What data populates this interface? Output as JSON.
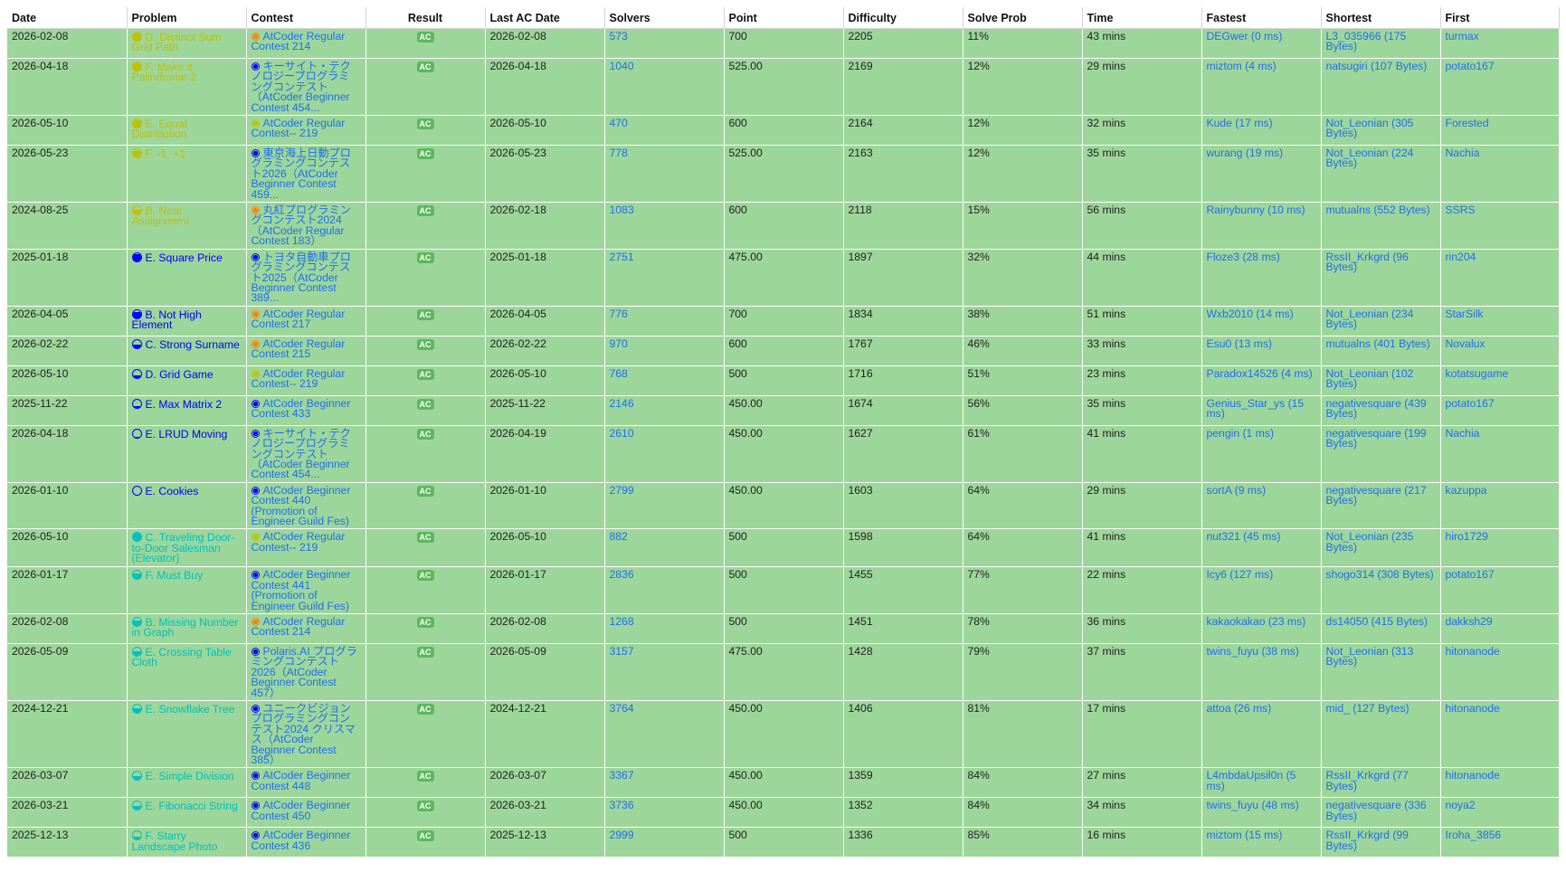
{
  "colors": {
    "row_bg": "#9dd69a",
    "link": "#1e6ff0",
    "yellow": "#c0c000",
    "blue": "#0000ff",
    "cyan": "#00c0c0",
    "ac_badge": "#5cb85c",
    "contest_abc": "#0000ff",
    "contest_arc": "#ff8000",
    "contest_arc_div": "#c0c000"
  },
  "headers": [
    "Date",
    "Problem",
    "Contest",
    "Result",
    "Last AC Date",
    "Solvers",
    "Point",
    "Difficulty",
    "Solve Prob",
    "Time",
    "Fastest",
    "Shortest",
    "First"
  ],
  "rows": [
    {
      "date": "2026-02-08",
      "problem": "D. Distinct Sum Grid Path",
      "color": "yellow",
      "fill": 0.9,
      "contest": "AtCoder Regular Contest 214",
      "ctype": "arc",
      "result": "AC",
      "last_ac": "2026-02-08",
      "solvers": "573",
      "point": "700",
      "difficulty": "2205",
      "prob": "11%",
      "time": "43 mins",
      "fastest": "DEGwer (0 ms)",
      "shortest": "L3_035966 (175 Bytes)",
      "first": "turmax"
    },
    {
      "date": "2026-04-18",
      "problem": "F. Make it Palindrome 2",
      "color": "yellow",
      "fill": 0.85,
      "contest": "キーサイト・テクノロジープログラミングコンテスト（AtCoder Beginner Contest 454...",
      "ctype": "abc",
      "result": "AC",
      "last_ac": "2026-04-18",
      "solvers": "1040",
      "point": "525.00",
      "difficulty": "2169",
      "prob": "12%",
      "time": "29 mins",
      "fastest": "miztom (4 ms)",
      "shortest": "natsugiri (107 Bytes)",
      "first": "potato167"
    },
    {
      "date": "2026-05-10",
      "problem": "E. Equal Distribution",
      "color": "yellow",
      "fill": 0.85,
      "contest": "AtCoder Regular Contest-- 219",
      "ctype": "arcdiv",
      "result": "AC",
      "last_ac": "2026-05-10",
      "solvers": "470",
      "point": "600",
      "difficulty": "2164",
      "prob": "12%",
      "time": "32 mins",
      "fastest": "Kude (17 ms)",
      "shortest": "Not_Leonian (305 Bytes)",
      "first": "Forested"
    },
    {
      "date": "2026-05-23",
      "problem": "F. -1, +1",
      "color": "yellow",
      "fill": 0.8,
      "contest": "東京海上日動プログラミングコンテスト2026（AtCoder Beginner Contest 459...",
      "ctype": "abc",
      "result": "AC",
      "last_ac": "2026-05-23",
      "solvers": "778",
      "point": "525.00",
      "difficulty": "2163",
      "prob": "12%",
      "time": "35 mins",
      "fastest": "wurang (19 ms)",
      "shortest": "Not_Leonian (224 Bytes)",
      "first": "Nachia"
    },
    {
      "date": "2024-08-25",
      "problem": "B. Near Assignment",
      "color": "yellow",
      "fill": 0.6,
      "contest": "丸紅プログラミングコンテスト2024（AtCoder Regular Contest 183）",
      "ctype": "arc",
      "result": "AC",
      "last_ac": "2026-02-18",
      "solvers": "1083",
      "point": "600",
      "difficulty": "2118",
      "prob": "15%",
      "time": "56 mins",
      "fastest": "Rainybunny (10 ms)",
      "shortest": "mutualns (552 Bytes)",
      "first": "SSRS"
    },
    {
      "date": "2025-01-18",
      "problem": "E. Square Price",
      "color": "blue",
      "fill": 0.9,
      "contest": "トヨタ自動車プログラミングコンテスト2025（AtCoder Beginner Contest 389...",
      "ctype": "abc",
      "result": "AC",
      "last_ac": "2025-01-18",
      "solvers": "2751",
      "point": "475.00",
      "difficulty": "1897",
      "prob": "32%",
      "time": "44 mins",
      "fastest": "Floze3 (28 ms)",
      "shortest": "RssII_Krkgrd (96 Bytes)",
      "first": "rin204"
    },
    {
      "date": "2026-04-05",
      "problem": "B. Not High Element",
      "color": "blue",
      "fill": 0.7,
      "contest": "AtCoder Regular Contest 217",
      "ctype": "arc",
      "result": "AC",
      "last_ac": "2026-04-05",
      "solvers": "776",
      "point": "700",
      "difficulty": "1834",
      "prob": "38%",
      "time": "51 mins",
      "fastest": "Wxb2010 (14 ms)",
      "shortest": "Not_Leonian (234 Bytes)",
      "first": "StarSilk"
    },
    {
      "date": "2026-02-22",
      "problem": "C. Strong Surname",
      "color": "blue",
      "fill": 0.45,
      "contest": "AtCoder Regular Contest 215",
      "ctype": "arc",
      "result": "AC",
      "last_ac": "2026-02-22",
      "solvers": "970",
      "point": "600",
      "difficulty": "1767",
      "prob": "46%",
      "time": "33 mins",
      "fastest": "Esu0 (13 ms)",
      "shortest": "mutualns (401 Bytes)",
      "first": "Novalux"
    },
    {
      "date": "2026-05-10",
      "problem": "D. Grid Game",
      "color": "blue",
      "fill": 0.3,
      "contest": "AtCoder Regular Contest-- 219",
      "ctype": "arcdiv",
      "result": "AC",
      "last_ac": "2026-05-10",
      "solvers": "768",
      "point": "500",
      "difficulty": "1716",
      "prob": "51%",
      "time": "23 mins",
      "fastest": "Paradox14526 (4 ms)",
      "shortest": "Not_Leonian (102 Bytes)",
      "first": "kotatsugame"
    },
    {
      "date": "2025-11-22",
      "problem": "E. Max Matrix 2",
      "color": "blue",
      "fill": 0.15,
      "contest": "AtCoder Beginner Contest 433",
      "ctype": "abc",
      "result": "AC",
      "last_ac": "2025-11-22",
      "solvers": "2146",
      "point": "450.00",
      "difficulty": "1674",
      "prob": "56%",
      "time": "35 mins",
      "fastest": "Genius_Star_ys (15 ms)",
      "shortest": "negativesquare (439 Bytes)",
      "first": "potato167"
    },
    {
      "date": "2026-04-18",
      "problem": "E. LRUD Moving",
      "color": "blue",
      "fill": 0.05,
      "contest": "キーサイト・テクノロジープログラミングコンテスト（AtCoder Beginner Contest 454...",
      "ctype": "abc",
      "result": "AC",
      "last_ac": "2026-04-19",
      "solvers": "2610",
      "point": "450.00",
      "difficulty": "1627",
      "prob": "61%",
      "time": "41 mins",
      "fastest": "pengin (1 ms)",
      "shortest": "negativesquare (199 Bytes)",
      "first": "Nachia"
    },
    {
      "date": "2026-01-10",
      "problem": "E. Cookies",
      "color": "blue",
      "fill": 0.0,
      "contest": "AtCoder Beginner Contest 440 (Promotion of Engineer Guild Fes)",
      "ctype": "abc",
      "result": "AC",
      "last_ac": "2026-01-10",
      "solvers": "2799",
      "point": "450.00",
      "difficulty": "1603",
      "prob": "64%",
      "time": "29 mins",
      "fastest": "sortA (9 ms)",
      "shortest": "negativesquare (217 Bytes)",
      "first": "kazuppa"
    },
    {
      "date": "2026-05-10",
      "problem": "C. Traveling Door-to-Door Salesman (Elevator)",
      "color": "cyan",
      "fill": 1.0,
      "contest": "AtCoder Regular Contest-- 219",
      "ctype": "arcdiv",
      "result": "AC",
      "last_ac": "2026-05-10",
      "solvers": "882",
      "point": "500",
      "difficulty": "1598",
      "prob": "64%",
      "time": "41 mins",
      "fastest": "nut321 (45 ms)",
      "shortest": "Not_Leonian (235 Bytes)",
      "first": "hiro1729"
    },
    {
      "date": "2026-01-17",
      "problem": "F. Must Buy",
      "color": "cyan",
      "fill": 0.7,
      "contest": "AtCoder Beginner Contest 441 (Promotion of Engineer Guild Fes)",
      "ctype": "abc",
      "result": "AC",
      "last_ac": "2026-01-17",
      "solvers": "2836",
      "point": "500",
      "difficulty": "1455",
      "prob": "77%",
      "time": "22 mins",
      "fastest": "Icy6 (127 ms)",
      "shortest": "shogo314 (308 Bytes)",
      "first": "potato167"
    },
    {
      "date": "2026-02-08",
      "problem": "B. Missing Number in Graph",
      "color": "cyan",
      "fill": 0.65,
      "contest": "AtCoder Regular Contest 214",
      "ctype": "arc",
      "result": "AC",
      "last_ac": "2026-02-08",
      "solvers": "1268",
      "point": "500",
      "difficulty": "1451",
      "prob": "78%",
      "time": "36 mins",
      "fastest": "kakaokakao (23 ms)",
      "shortest": "ds14050 (415 Bytes)",
      "first": "dakksh29"
    },
    {
      "date": "2026-05-09",
      "problem": "E. Crossing Table Cloth",
      "color": "cyan",
      "fill": 0.6,
      "contest": "Polaris.AI プログラミングコンテスト 2026（AtCoder Beginner Contest 457）",
      "ctype": "abc",
      "result": "AC",
      "last_ac": "2026-05-09",
      "solvers": "3157",
      "point": "475.00",
      "difficulty": "1428",
      "prob": "79%",
      "time": "37 mins",
      "fastest": "twins_fuyu (38 ms)",
      "shortest": "Not_Leonian (313 Bytes)",
      "first": "hitonanode"
    },
    {
      "date": "2024-12-21",
      "problem": "E. Snowflake Tree",
      "color": "cyan",
      "fill": 0.55,
      "contest": "ユニークビジョンプログラミングコンテスト2024 クリスマス（AtCoder Beginner Contest 385）",
      "ctype": "abc",
      "result": "AC",
      "last_ac": "2024-12-21",
      "solvers": "3764",
      "point": "450.00",
      "difficulty": "1406",
      "prob": "81%",
      "time": "17 mins",
      "fastest": "attoa (26 ms)",
      "shortest": "mid_ (127 Bytes)",
      "first": "hitonanode"
    },
    {
      "date": "2026-03-07",
      "problem": "E. Simple Division",
      "color": "cyan",
      "fill": 0.45,
      "contest": "AtCoder Beginner Contest 448",
      "ctype": "abc",
      "result": "AC",
      "last_ac": "2026-03-07",
      "solvers": "3367",
      "point": "450.00",
      "difficulty": "1359",
      "prob": "84%",
      "time": "27 mins",
      "fastest": "L4mbdaUpsil0n (5 ms)",
      "shortest": "RssII_Krkgrd (77 Bytes)",
      "first": "hitonanode"
    },
    {
      "date": "2026-03-21",
      "problem": "E. Fibonacci String",
      "color": "cyan",
      "fill": 0.45,
      "contest": "AtCoder Beginner Contest 450",
      "ctype": "abc",
      "result": "AC",
      "last_ac": "2026-03-21",
      "solvers": "3736",
      "point": "450.00",
      "difficulty": "1352",
      "prob": "84%",
      "time": "34 mins",
      "fastest": "twins_fuyu (48 ms)",
      "shortest": "negativesquare (336 Bytes)",
      "first": "noya2"
    },
    {
      "date": "2025-12-13",
      "problem": "F. Starry Landscape Photo",
      "color": "cyan",
      "fill": 0.4,
      "contest": "AtCoder Beginner Contest 436",
      "ctype": "abc",
      "result": "AC",
      "last_ac": "2025-12-13",
      "solvers": "2999",
      "point": "500",
      "difficulty": "1336",
      "prob": "85%",
      "time": "16 mins",
      "fastest": "miztom (15 ms)",
      "shortest": "RssII_Krkgrd (99 Bytes)",
      "first": "Iroha_3856"
    }
  ]
}
